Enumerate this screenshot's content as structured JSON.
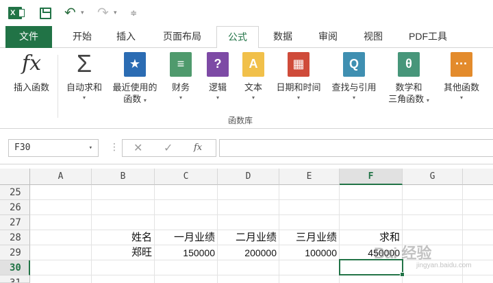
{
  "quick_access": {
    "app_icon": "excel-logo",
    "icons": [
      "save-icon",
      "undo-icon",
      "redo-icon",
      "customize-icon"
    ]
  },
  "ribbon_tabs": [
    {
      "label": "文件"
    },
    {
      "label": "开始"
    },
    {
      "label": "插入"
    },
    {
      "label": "页面布局"
    },
    {
      "label": "公式"
    },
    {
      "label": "数据"
    },
    {
      "label": "审阅"
    },
    {
      "label": "视图"
    },
    {
      "label": "PDF工具"
    }
  ],
  "ribbon": {
    "insert_function": "插入函数",
    "autosum": "自动求和",
    "recent": "最近使用的",
    "recent2": "函数",
    "financial": "财务",
    "logical": "逻辑",
    "text": "文本",
    "datetime": "日期和时间",
    "lookup": "查找与引用",
    "math": "数学和",
    "math2": "三角函数",
    "more": "其他函数",
    "group_label": "函数库",
    "fx_symbol": "fx",
    "sigma_symbol": "Σ",
    "financial_glyph": "≡",
    "logical_glyph": "?",
    "text_glyph": "A",
    "datetime_glyph": "▦",
    "lookup_glyph": "Q",
    "math_glyph": "θ",
    "more_glyph": "···",
    "recent_glyph": "★"
  },
  "formula_bar": {
    "name_box": "F30",
    "formula": "",
    "cancel": "✕",
    "enter": "✓",
    "fx": "fx"
  },
  "sheet": {
    "columns": [
      "A",
      "B",
      "C",
      "D",
      "E",
      "F",
      "G"
    ],
    "rows": [
      "25",
      "26",
      "27",
      "28",
      "29",
      "30",
      "31"
    ],
    "selected_column": "F",
    "selected_row": "30",
    "row28": {
      "B": "姓名",
      "C": "一月业绩",
      "D": "二月业绩",
      "E": "三月业绩",
      "F": "求和"
    },
    "row29": {
      "B": "郑旺",
      "C": "150000",
      "D": "200000",
      "E": "100000",
      "F": "450000"
    }
  },
  "watermark": {
    "text": "Bai 经验",
    "url": "jingyan.baidu.com"
  },
  "colors": {
    "excel_green": "#217346"
  }
}
